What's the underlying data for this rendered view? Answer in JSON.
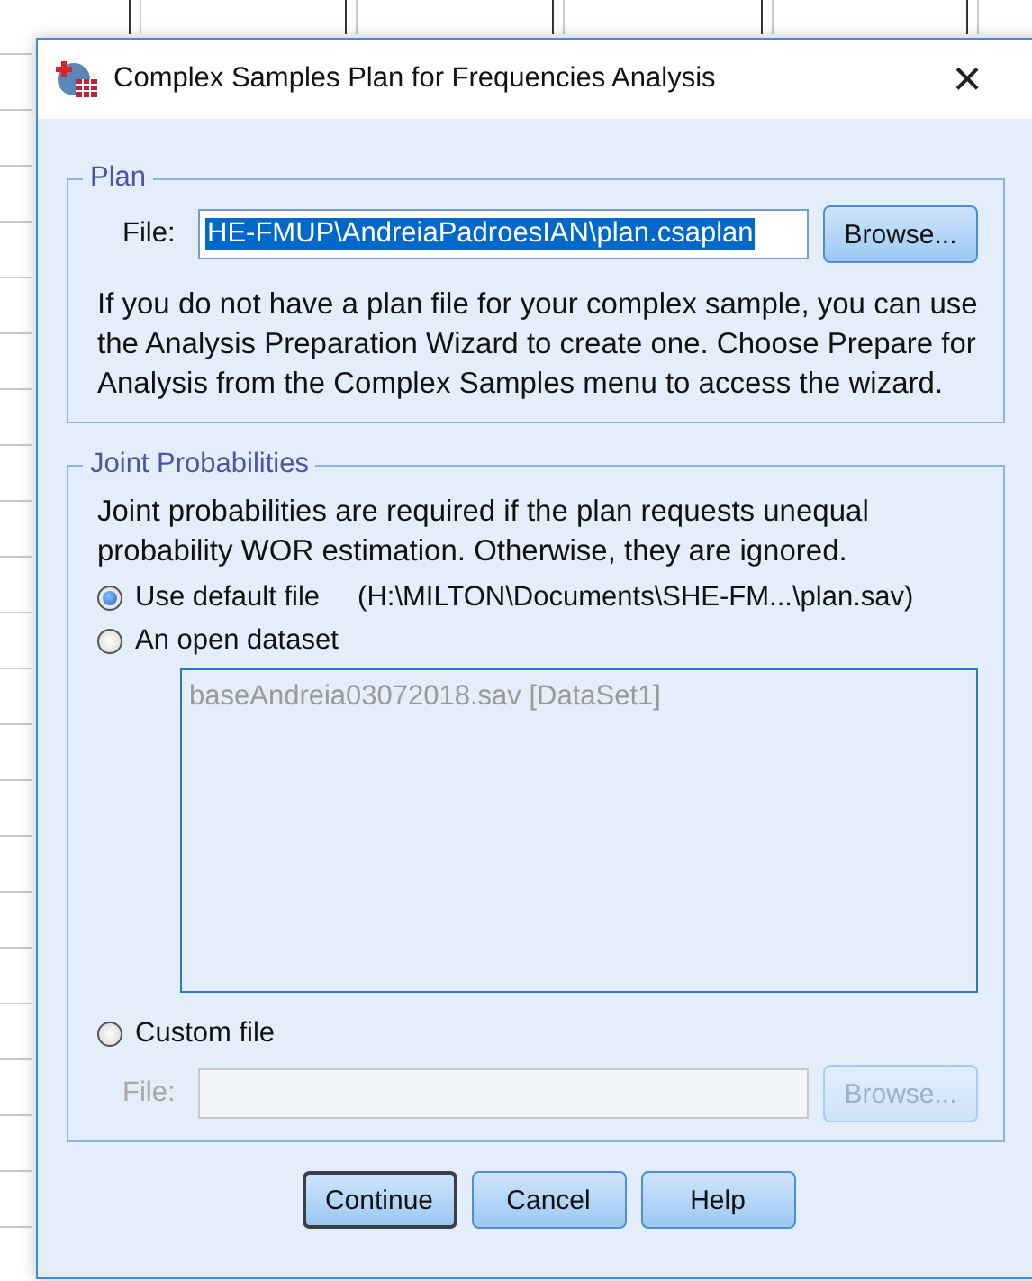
{
  "window": {
    "title": "Complex Samples Plan for Frequencies Analysis",
    "close": "×"
  },
  "plan": {
    "title": "Plan",
    "file_label": "File:",
    "file_value": "HE-FMUP\\AndreiaPadroesIAN\\plan.csaplan",
    "text_selected": true,
    "browse": {
      "label": "Browse...",
      "disabled": false
    },
    "description": "If you do not have a plan file for your complex sample, you can use the Analysis Preparation Wizard to create one. Choose Prepare for Analysis from the Complex Samples menu to access the wizard."
  },
  "joint_probabilities": {
    "title": "Joint Probabilities",
    "description": "Joint probabilities are required if the plan requests unequal probability WOR estimation. Otherwise, they are ignored.",
    "options": [
      {
        "kind": "default",
        "label": "Use default file",
        "path": "(H:\\MILTON\\Documents\\SHE-FM...\\plan.sav)",
        "selected": true
      },
      {
        "kind": "dataset",
        "label": "An open dataset",
        "selected": false,
        "datasets": [
          {
            "label": "baseAndreia03072018.sav [DataSet1]",
            "disabled": true
          }
        ]
      },
      {
        "kind": "custom",
        "label": "Custom file",
        "selected": false,
        "file_label": "File:",
        "browse": {
          "label": "Browse...",
          "disabled": true
        },
        "disabled": true
      }
    ]
  },
  "buttons": [
    {
      "label": "Continue",
      "default": true
    },
    {
      "label": "Cancel",
      "default": false
    },
    {
      "label": "Help",
      "default": false
    }
  ]
}
